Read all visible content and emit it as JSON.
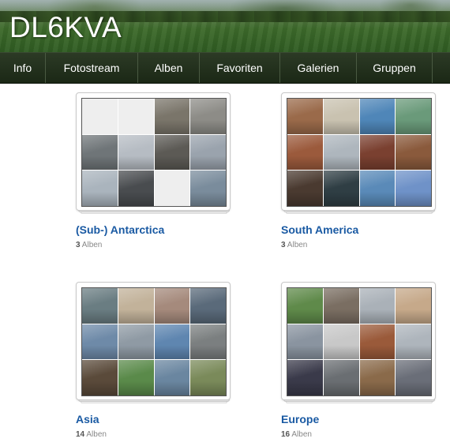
{
  "header": {
    "site_title": "DL6KVA"
  },
  "nav": {
    "items": [
      {
        "label": "Info"
      },
      {
        "label": "Fotostream"
      },
      {
        "label": "Alben"
      },
      {
        "label": "Favoriten"
      },
      {
        "label": "Galerien"
      },
      {
        "label": "Gruppen"
      }
    ]
  },
  "collections": [
    {
      "title": "(Sub-) Antarctica",
      "count": "3",
      "count_label": "Alben",
      "thumbs": [
        "",
        "",
        "#7a756a",
        "#8d8c87",
        "#6f7578",
        "#b6bcc3",
        "#5c5a55",
        "#9aa3ad",
        "#aab4bd",
        "#494c4f",
        "",
        "#7a8c9c"
      ]
    },
    {
      "title": "South America",
      "count": "3",
      "count_label": "Alben",
      "thumbs": [
        "#9a6a4a",
        "#c9c2b0",
        "#4f86b8",
        "#6a9a7a",
        "#9b5a3c",
        "#aeb6bd",
        "#7a4030",
        "#8a5a3c",
        "#4a3a30",
        "#2f3e44",
        "#5a8ab8",
        "#6f92c8"
      ]
    },
    {
      "title": "Asia",
      "count": "14",
      "count_label": "Alben",
      "thumbs": [
        "#6a7d82",
        "#c2b29a",
        "#a58a7c",
        "#5a6a7a",
        "#6e8aa8",
        "#8f9aa4",
        "#5f86b0",
        "#7b7f80",
        "#5a4a3a",
        "#5a8a4a",
        "#6a86a0",
        "#7a8a5a"
      ]
    },
    {
      "title": "Europe",
      "count": "16",
      "count_label": "Alben",
      "thumbs": [
        "#5f8a4a",
        "#7a6e62",
        "#aab1b8",
        "#c6a98a",
        "#8a94a0",
        "#c8c8c8",
        "#9a5a3a",
        "#aeb5bc",
        "#3a3a4a",
        "#6a6e72",
        "#8a6a4a",
        "#6a6e78"
      ]
    }
  ]
}
